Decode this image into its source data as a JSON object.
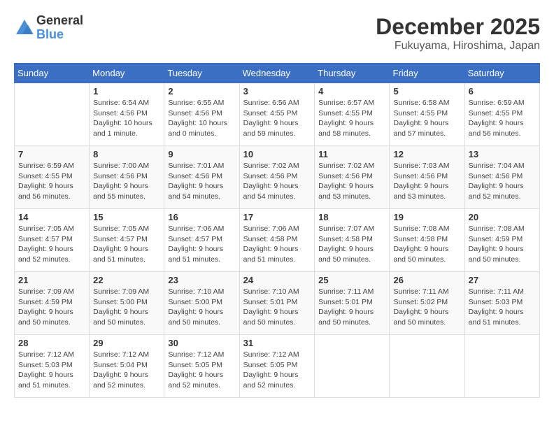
{
  "logo": {
    "general": "General",
    "blue": "Blue"
  },
  "title": {
    "month": "December 2025",
    "location": "Fukuyama, Hiroshima, Japan"
  },
  "headers": [
    "Sunday",
    "Monday",
    "Tuesday",
    "Wednesday",
    "Thursday",
    "Friday",
    "Saturday"
  ],
  "weeks": [
    [
      {
        "day": "",
        "details": ""
      },
      {
        "day": "1",
        "details": "Sunrise: 6:54 AM\nSunset: 4:56 PM\nDaylight: 10 hours\nand 1 minute."
      },
      {
        "day": "2",
        "details": "Sunrise: 6:55 AM\nSunset: 4:56 PM\nDaylight: 10 hours\nand 0 minutes."
      },
      {
        "day": "3",
        "details": "Sunrise: 6:56 AM\nSunset: 4:55 PM\nDaylight: 9 hours\nand 59 minutes."
      },
      {
        "day": "4",
        "details": "Sunrise: 6:57 AM\nSunset: 4:55 PM\nDaylight: 9 hours\nand 58 minutes."
      },
      {
        "day": "5",
        "details": "Sunrise: 6:58 AM\nSunset: 4:55 PM\nDaylight: 9 hours\nand 57 minutes."
      },
      {
        "day": "6",
        "details": "Sunrise: 6:59 AM\nSunset: 4:55 PM\nDaylight: 9 hours\nand 56 minutes."
      }
    ],
    [
      {
        "day": "7",
        "details": "Sunrise: 6:59 AM\nSunset: 4:55 PM\nDaylight: 9 hours\nand 56 minutes."
      },
      {
        "day": "8",
        "details": "Sunrise: 7:00 AM\nSunset: 4:56 PM\nDaylight: 9 hours\nand 55 minutes."
      },
      {
        "day": "9",
        "details": "Sunrise: 7:01 AM\nSunset: 4:56 PM\nDaylight: 9 hours\nand 54 minutes."
      },
      {
        "day": "10",
        "details": "Sunrise: 7:02 AM\nSunset: 4:56 PM\nDaylight: 9 hours\nand 54 minutes."
      },
      {
        "day": "11",
        "details": "Sunrise: 7:02 AM\nSunset: 4:56 PM\nDaylight: 9 hours\nand 53 minutes."
      },
      {
        "day": "12",
        "details": "Sunrise: 7:03 AM\nSunset: 4:56 PM\nDaylight: 9 hours\nand 53 minutes."
      },
      {
        "day": "13",
        "details": "Sunrise: 7:04 AM\nSunset: 4:56 PM\nDaylight: 9 hours\nand 52 minutes."
      }
    ],
    [
      {
        "day": "14",
        "details": "Sunrise: 7:05 AM\nSunset: 4:57 PM\nDaylight: 9 hours\nand 52 minutes."
      },
      {
        "day": "15",
        "details": "Sunrise: 7:05 AM\nSunset: 4:57 PM\nDaylight: 9 hours\nand 51 minutes."
      },
      {
        "day": "16",
        "details": "Sunrise: 7:06 AM\nSunset: 4:57 PM\nDaylight: 9 hours\nand 51 minutes."
      },
      {
        "day": "17",
        "details": "Sunrise: 7:06 AM\nSunset: 4:58 PM\nDaylight: 9 hours\nand 51 minutes."
      },
      {
        "day": "18",
        "details": "Sunrise: 7:07 AM\nSunset: 4:58 PM\nDaylight: 9 hours\nand 50 minutes."
      },
      {
        "day": "19",
        "details": "Sunrise: 7:08 AM\nSunset: 4:58 PM\nDaylight: 9 hours\nand 50 minutes."
      },
      {
        "day": "20",
        "details": "Sunrise: 7:08 AM\nSunset: 4:59 PM\nDaylight: 9 hours\nand 50 minutes."
      }
    ],
    [
      {
        "day": "21",
        "details": "Sunrise: 7:09 AM\nSunset: 4:59 PM\nDaylight: 9 hours\nand 50 minutes."
      },
      {
        "day": "22",
        "details": "Sunrise: 7:09 AM\nSunset: 5:00 PM\nDaylight: 9 hours\nand 50 minutes."
      },
      {
        "day": "23",
        "details": "Sunrise: 7:10 AM\nSunset: 5:00 PM\nDaylight: 9 hours\nand 50 minutes."
      },
      {
        "day": "24",
        "details": "Sunrise: 7:10 AM\nSunset: 5:01 PM\nDaylight: 9 hours\nand 50 minutes."
      },
      {
        "day": "25",
        "details": "Sunrise: 7:11 AM\nSunset: 5:01 PM\nDaylight: 9 hours\nand 50 minutes."
      },
      {
        "day": "26",
        "details": "Sunrise: 7:11 AM\nSunset: 5:02 PM\nDaylight: 9 hours\nand 50 minutes."
      },
      {
        "day": "27",
        "details": "Sunrise: 7:11 AM\nSunset: 5:03 PM\nDaylight: 9 hours\nand 51 minutes."
      }
    ],
    [
      {
        "day": "28",
        "details": "Sunrise: 7:12 AM\nSunset: 5:03 PM\nDaylight: 9 hours\nand 51 minutes."
      },
      {
        "day": "29",
        "details": "Sunrise: 7:12 AM\nSunset: 5:04 PM\nDaylight: 9 hours\nand 52 minutes."
      },
      {
        "day": "30",
        "details": "Sunrise: 7:12 AM\nSunset: 5:05 PM\nDaylight: 9 hours\nand 52 minutes."
      },
      {
        "day": "31",
        "details": "Sunrise: 7:12 AM\nSunset: 5:05 PM\nDaylight: 9 hours\nand 52 minutes."
      },
      {
        "day": "",
        "details": ""
      },
      {
        "day": "",
        "details": ""
      },
      {
        "day": "",
        "details": ""
      }
    ]
  ]
}
